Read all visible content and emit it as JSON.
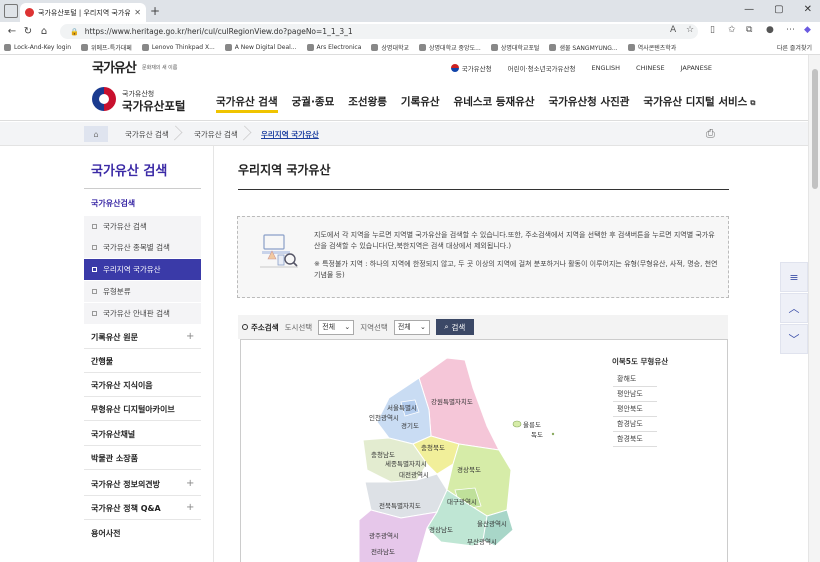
{
  "browser": {
    "tab_title": "국가유산포털 | 우리지역 국가유산",
    "new_tab": "+",
    "url": "https://www.heritage.go.kr/heri/cul/culRegionView.do?pageNo=1_1_3_1",
    "bookmarks": [
      "Lock-And-Key login",
      "위메프-특가대페",
      "Lenovo Thinkpad X...",
      "A New Digital Deal...",
      "Ars Electronica",
      "상명대학교",
      "상명대학교 중앙도...",
      "상명대학교포털",
      "샘물 SANGMYUNG...",
      "역사콘텐츠학과"
    ],
    "bookmarks_other": "다른 즐겨찾기"
  },
  "util": {
    "logo": "국가유산",
    "logo_sub": "문화재의 새 이름",
    "links": [
      "국가유산청",
      "어린이·청소년국가유산청",
      "ENGLISH",
      "CHINESE",
      "JAPANESE"
    ]
  },
  "header": {
    "org": "국가유산청",
    "portal": "국가유산포털",
    "gnb": [
      "국가유산 검색",
      "궁궐·종묘",
      "조선왕릉",
      "기록유산",
      "유네스코 등재유산",
      "국가유산청 사진관",
      "국가유산 디지털 서비스"
    ]
  },
  "breadcrumb": [
    "국가유산 검색",
    "국가유산 검색",
    "우리지역 국가유산"
  ],
  "sidebar": {
    "title": "국가유산 검색",
    "selected": "국가유산검색",
    "subs": [
      "국가유산 검색",
      "국가유산 종목별 검색",
      "우리지역 국가유산",
      "유형분류",
      "국가유산 안내판 검색"
    ],
    "items": [
      "기록유산 원문",
      "간행물",
      "국가유산 지식이음",
      "무형유산 디지털아카이브",
      "국가유산채널",
      "박물관 소장품",
      "국가유산 정보의견방",
      "국가유산 정책 Q&A",
      "용어사전"
    ]
  },
  "content": {
    "title": "우리지역 국가유산",
    "info1": "지도에서 각 지역을 누르면 지역별 국가유산을 검색할 수 있습니다.또한, 주소검색에서 지역을 선택한 후 검색버튼을 누르면 지역별 국가유산을 검색할 수 있습니다(단,북한지역은 검색 대상에서 제외됩니다.)",
    "info2": "※ 특정불가 지역 : 하나의 지역에 한정되지 않고, 두 곳 이상의 지역에 걸쳐 분포하거나 활동이 이루어지는 유형(무형유산, 사적, 명승, 천연기념물 등)",
    "search": {
      "label": "주소검색",
      "sido_label": "도시선택",
      "sido_value": "전체",
      "region_label": "지역선택",
      "region_value": "전체",
      "button": "검색"
    },
    "map_regions": [
      "강원특별자치도",
      "인천광역시",
      "서울특별시",
      "경기도",
      "충청북도",
      "충청남도",
      "세종특별자치시",
      "대전광역시",
      "경상북도",
      "전북특별자치도",
      "대구광역시",
      "울산광역시",
      "경상남도",
      "광주광역시",
      "부산광역시",
      "전라남도",
      "울릉도",
      "독도"
    ],
    "nk_title": "이북5도 무형유산",
    "nk_list": [
      "황해도",
      "평안남도",
      "평안북도",
      "함경남도",
      "함경북도"
    ]
  },
  "float_buttons": [
    "≡",
    "︿",
    "﹀"
  ]
}
